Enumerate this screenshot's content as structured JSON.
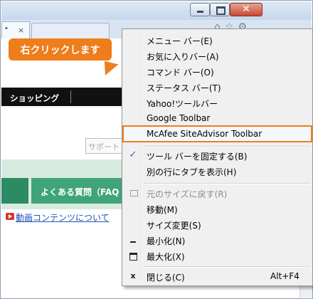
{
  "browser": {
    "tab_close_glyph": "×",
    "tab_dots": "•",
    "toolbar_icons": "⌂☆⚙",
    "close_glyph": "✕"
  },
  "page": {
    "nav_label": "ショッピング",
    "search_placeholder": "サポート",
    "faq_label": "よくある質問（FAQ",
    "video_link": "動画コンテンツについて"
  },
  "callout": {
    "text": "右クリックします",
    "color": "#ee7d1c"
  },
  "menu": {
    "items": [
      {
        "label": "メニュー バー(E)"
      },
      {
        "label": "お気に入りバー(A)"
      },
      {
        "label": "コマンド バー(O)"
      },
      {
        "label": "ステータス バー(T)"
      },
      {
        "label": "Yahoo!ツールバー"
      },
      {
        "label": "Google Toolbar"
      },
      {
        "label": "McAfee SiteAdvisor Toolbar",
        "highlighted": true
      },
      {
        "label": "ツール バーを固定する(B)",
        "checked": true,
        "icon": "checkmark-icon"
      },
      {
        "label": "別の行にタブを表示(H)"
      },
      {
        "label": "元のサイズに戻す(R)",
        "disabled": true,
        "icon": "restore-icon"
      },
      {
        "label": "移動(M)"
      },
      {
        "label": "サイズ変更(S)"
      },
      {
        "label": "最小化(N)",
        "icon": "minimize-icon"
      },
      {
        "label": "最大化(X)",
        "icon": "maximize-icon"
      },
      {
        "label": "閉じる(C)",
        "icon": "close-icon",
        "shortcut": "Alt+F4"
      }
    ],
    "check_glyph": "✓",
    "close_glyph": "x"
  }
}
